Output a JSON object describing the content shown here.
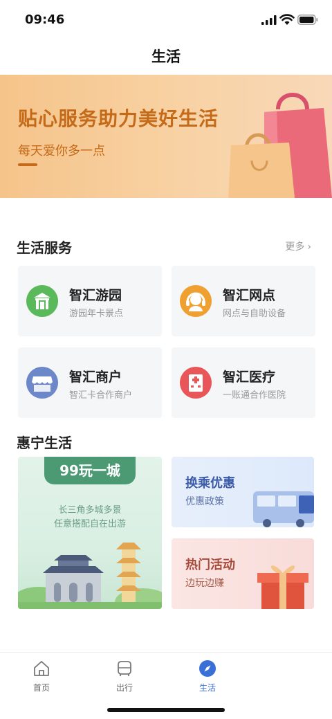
{
  "status_bar": {
    "time": "09:46"
  },
  "nav": {
    "title": "生活"
  },
  "banner": {
    "title": "贴心服务助力美好生活",
    "subtitle": "每天爱你多一点"
  },
  "services": {
    "title": "生活服务",
    "more": "更多",
    "items": [
      {
        "name": "智汇游园",
        "desc": "游园年卡景点",
        "icon": "park-gate-icon",
        "color": "#5ab95a"
      },
      {
        "name": "智汇网点",
        "desc": "网点与自助设备",
        "icon": "service-agent-icon",
        "color": "#f0a030"
      },
      {
        "name": "智汇商户",
        "desc": "智汇卡合作商户",
        "icon": "shop-awning-icon",
        "color": "#6d88c8"
      },
      {
        "name": "智汇医疗",
        "desc": "一账通合作医院",
        "icon": "hospital-icon",
        "color": "#e9565a"
      }
    ]
  },
  "huining": {
    "title": "惠宁生活",
    "big_card": {
      "tag": "99玩一城",
      "line1": "长三角多城多景",
      "line2": "任意搭配自在出游"
    },
    "cards": [
      {
        "title": "换乘优惠",
        "sub": "优惠政策"
      },
      {
        "title": "热门活动",
        "sub": "边玩边赚"
      }
    ]
  },
  "tab_bar": {
    "tabs": [
      {
        "label": "首页",
        "icon": "home-icon"
      },
      {
        "label": "出行",
        "icon": "bus-icon"
      },
      {
        "label": "生活",
        "icon": "compass-icon",
        "active": true
      }
    ]
  },
  "colors": {
    "accent": "#3b6fd8",
    "banner_text": "#c46a18"
  }
}
